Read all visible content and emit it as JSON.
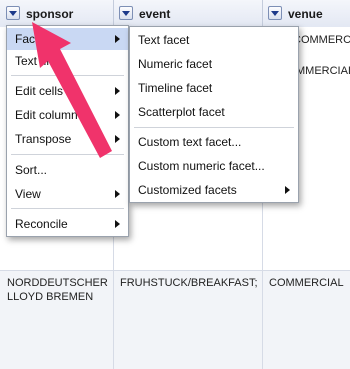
{
  "columns": [
    {
      "label": "sponsor"
    },
    {
      "label": "event"
    },
    {
      "label": "venue"
    }
  ],
  "rows": [
    {
      "sponsor": "",
      "event": "",
      "venue": "MMERCIAL"
    },
    {
      "sponsor": "NORDDEUTSCHER LLOYD BREMEN",
      "event": "FRUHSTUCK/BREAKFAST;",
      "venue": "COMMERCIAL"
    }
  ],
  "venue_peek_top": "COMMERCIAL",
  "column_menu": {
    "items": [
      {
        "label": "Facet"
      },
      {
        "label": "Text filter"
      },
      {
        "label": "Edit cells"
      },
      {
        "label": "Edit column"
      },
      {
        "label": "Transpose"
      },
      {
        "label": "Sort..."
      },
      {
        "label": "View"
      },
      {
        "label": "Reconcile"
      }
    ]
  },
  "facet_submenu": {
    "items": [
      {
        "label": "Text facet"
      },
      {
        "label": "Numeric facet"
      },
      {
        "label": "Timeline facet"
      },
      {
        "label": "Scatterplot facet"
      },
      {
        "label": "Custom text facet..."
      },
      {
        "label": "Custom numeric facet..."
      },
      {
        "label": "Customized facets"
      }
    ]
  },
  "colors": {
    "header_bg": "#e3e8f3",
    "menu_highlight": "#c9d8f3",
    "annotation_arrow": "#f0336b"
  }
}
